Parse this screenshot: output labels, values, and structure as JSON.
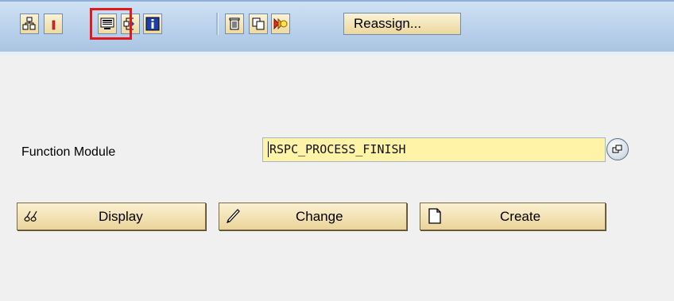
{
  "toolbar": {
    "reassign_label": "Reassign...",
    "buttons": [
      {
        "icon": "hierarchy-icon"
      },
      {
        "icon": "activate-icon"
      },
      {
        "icon": "screen-display-icon",
        "highlighted": true
      },
      {
        "icon": "where-used-icon"
      },
      {
        "icon": "info-icon"
      },
      {
        "icon": "delete-icon"
      },
      {
        "icon": "copy-icon"
      },
      {
        "icon": "rename-icon"
      }
    ]
  },
  "form": {
    "function_module_label": "Function Module",
    "function_module_value": "RSPC_PROCESS_FINISH"
  },
  "actions": {
    "display_label": "Display",
    "change_label": "Change",
    "create_label": "Create"
  },
  "colors": {
    "highlight": "#e0191f",
    "input_bg": "#fff3a8",
    "button_bg": "#f3e2b4"
  }
}
